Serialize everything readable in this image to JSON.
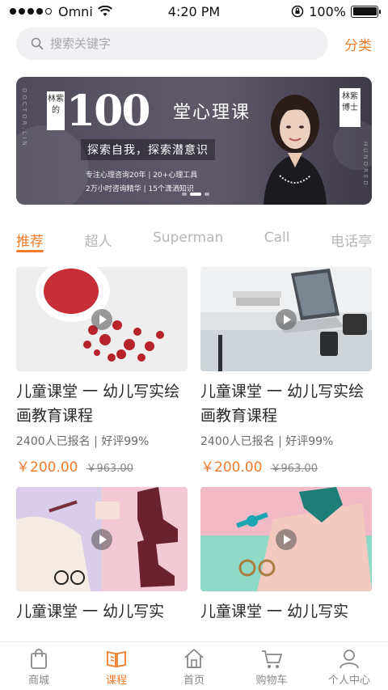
{
  "status_bar": {
    "carrier": "Omni",
    "time": "4:20 PM",
    "battery": "100%",
    "battery_level": 1.0,
    "signal_bars_filled": 4,
    "signal_bars_total": 5
  },
  "search": {
    "placeholder": "搜索关键字",
    "icon": "search-icon",
    "category_label": "分类"
  },
  "banner": {
    "vertical_left": "DOCTOR.LIN",
    "vertical_right": "HUNDRED",
    "seal": "林紫的",
    "big_number": "100",
    "title": "堂心理课",
    "subtitle": "探索自我，探索潜意识",
    "line1": "专注心理咨询20年 | 20+心理工具",
    "line2": "2万小时咨询精华 | 15个潇洒知识",
    "doctor_tag": "林紫博士",
    "slide_count": 3,
    "active_slide": 2
  },
  "tabs": [
    {
      "label": "推荐",
      "active": true
    },
    {
      "label": "超人",
      "active": false
    },
    {
      "label": "Superman",
      "active": false
    },
    {
      "label": "Call",
      "active": false
    },
    {
      "label": "电话亭",
      "active": false
    }
  ],
  "courses": [
    {
      "title": "儿童课堂 一 幼儿写实绘画教育课程",
      "meta": "2400人已报名 | 好评99%",
      "price": "￥200.00",
      "old_price": "￥963.00",
      "image": "dried-berries"
    },
    {
      "title": "儿童课堂 一 幼儿写实绘画教育课程",
      "meta": "2400人已报名 | 好评99%",
      "price": "￥200.00",
      "old_price": "￥963.00",
      "image": "laptop-desk"
    },
    {
      "title": "儿童课堂 一 幼儿写实",
      "meta": "",
      "price": "",
      "old_price": "",
      "image": "fashion-flatlay"
    },
    {
      "title": "儿童课堂 一 幼儿写实",
      "meta": "",
      "price": "",
      "old_price": "",
      "image": "shirt-watch"
    }
  ],
  "bottom_nav": [
    {
      "label": "商城",
      "icon": "bag-icon",
      "active": false
    },
    {
      "label": "课程",
      "icon": "book-icon",
      "active": true
    },
    {
      "label": "首页",
      "icon": "home-icon",
      "active": false
    },
    {
      "label": "购物车",
      "icon": "cart-icon",
      "active": false
    },
    {
      "label": "个人中心",
      "icon": "person-icon",
      "active": false
    }
  ],
  "colors": {
    "accent": "#f07c2a",
    "text": "#2a2a2a",
    "muted": "#b6b6b8",
    "search_bg": "#f1f1f3"
  }
}
